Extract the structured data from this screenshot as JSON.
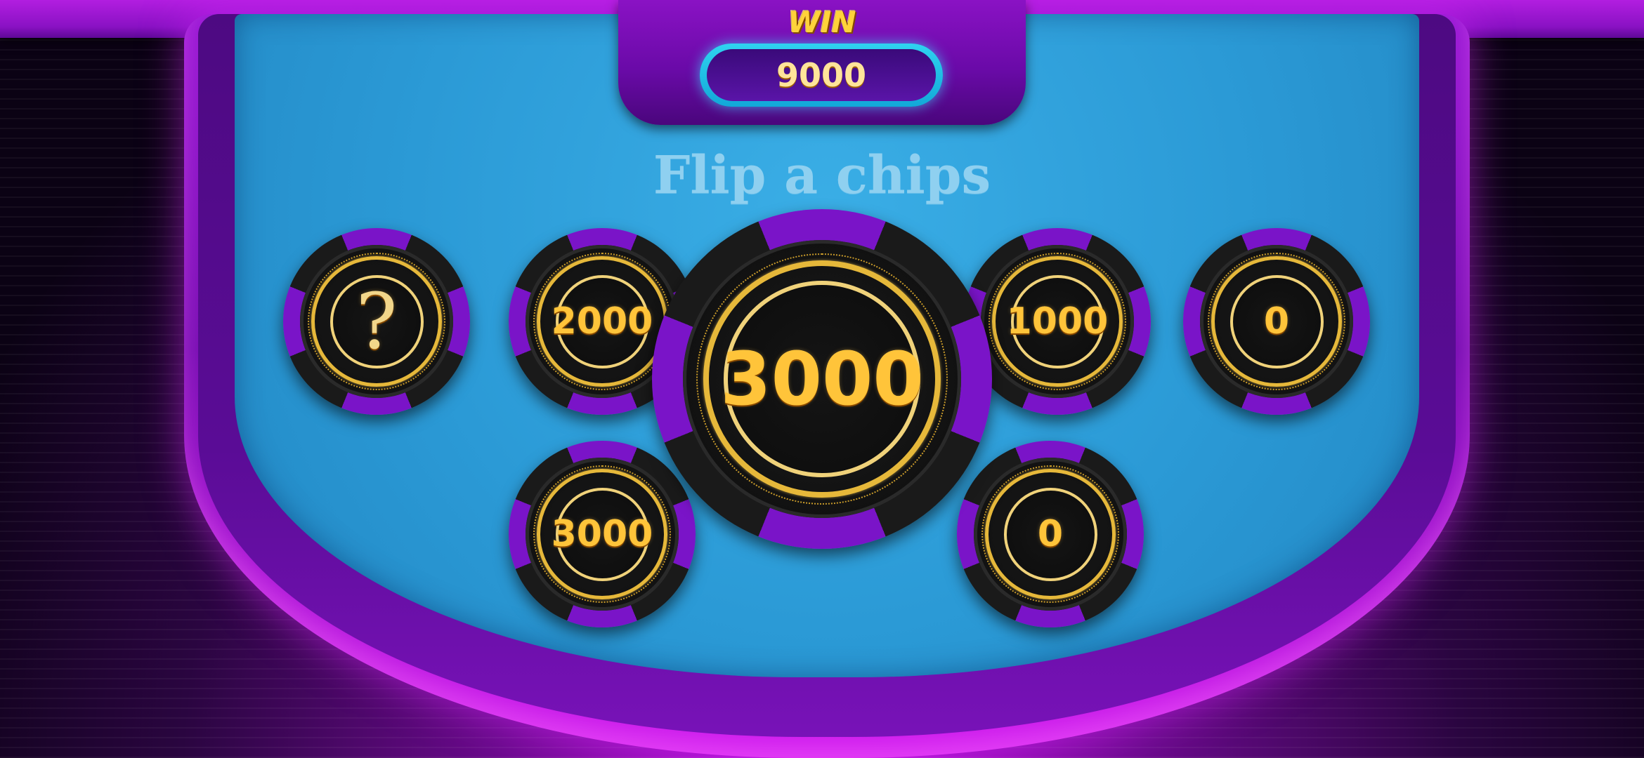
{
  "header": {
    "win_label": "WIN",
    "win_amount": "9000"
  },
  "title": "Flip a chips",
  "chips": [
    {
      "id": "chip-1",
      "value": "?",
      "state": "hidden"
    },
    {
      "id": "chip-2",
      "value": "2000",
      "state": "revealed"
    },
    {
      "id": "chip-3",
      "value": "3000",
      "state": "selected"
    },
    {
      "id": "chip-4",
      "value": "1000",
      "state": "revealed"
    },
    {
      "id": "chip-5",
      "value": "0",
      "state": "revealed"
    },
    {
      "id": "chip-6",
      "value": "3000",
      "state": "revealed"
    },
    {
      "id": "chip-7",
      "value": "0",
      "state": "revealed"
    }
  ],
  "colors": {
    "felt": "#2b9ad6",
    "rim": "#9c1ad6",
    "chip_accent": "#7a14c8",
    "gold": "#ffc43a"
  }
}
